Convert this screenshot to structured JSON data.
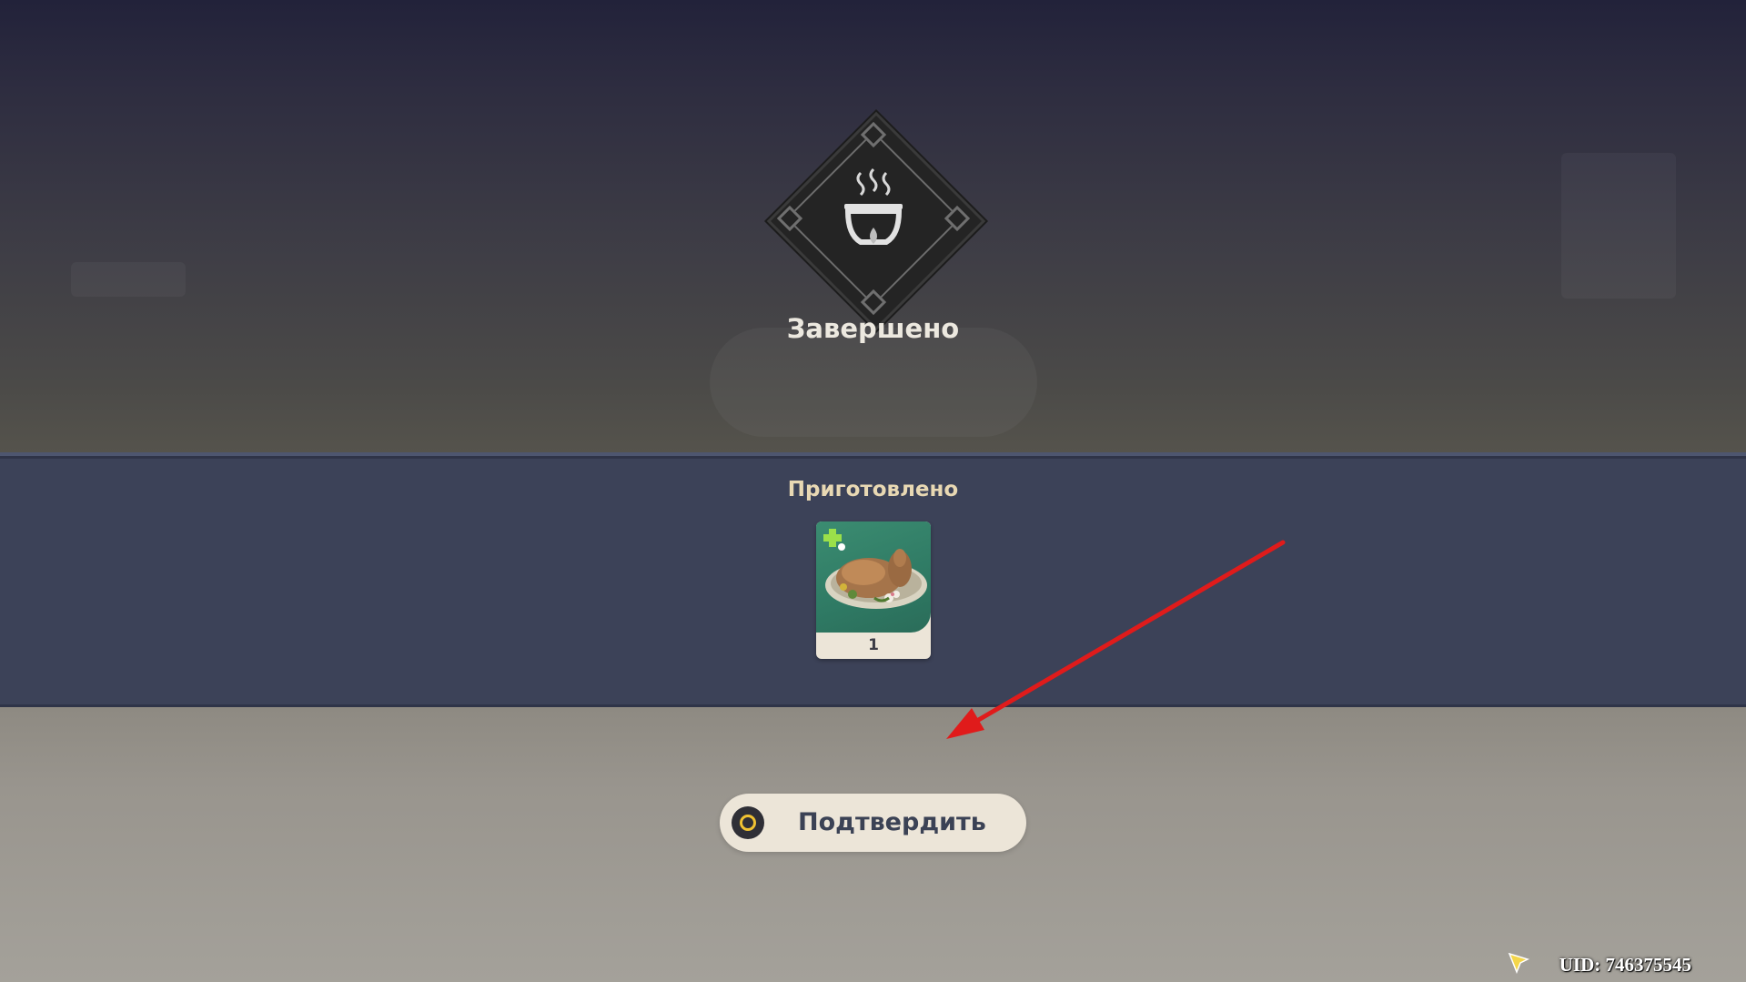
{
  "header": {
    "status_title": "Завершено",
    "emblem_icon": "cooking-pot-icon"
  },
  "result": {
    "section_title": "Приготовлено",
    "items": [
      {
        "icon": "roast-chicken-dish-icon",
        "count": "1",
        "badge_icon": "plus-heal-icon",
        "rarity_color": "#3b8c71"
      }
    ]
  },
  "actions": {
    "confirm_label": "Подтвердить",
    "confirm_icon": "circle-button-icon",
    "confirm_icon_color": "#f0c232"
  },
  "overlay": {
    "arrow_color": "#e01b1b"
  },
  "footer": {
    "uid_text": "UID: 746375545"
  }
}
